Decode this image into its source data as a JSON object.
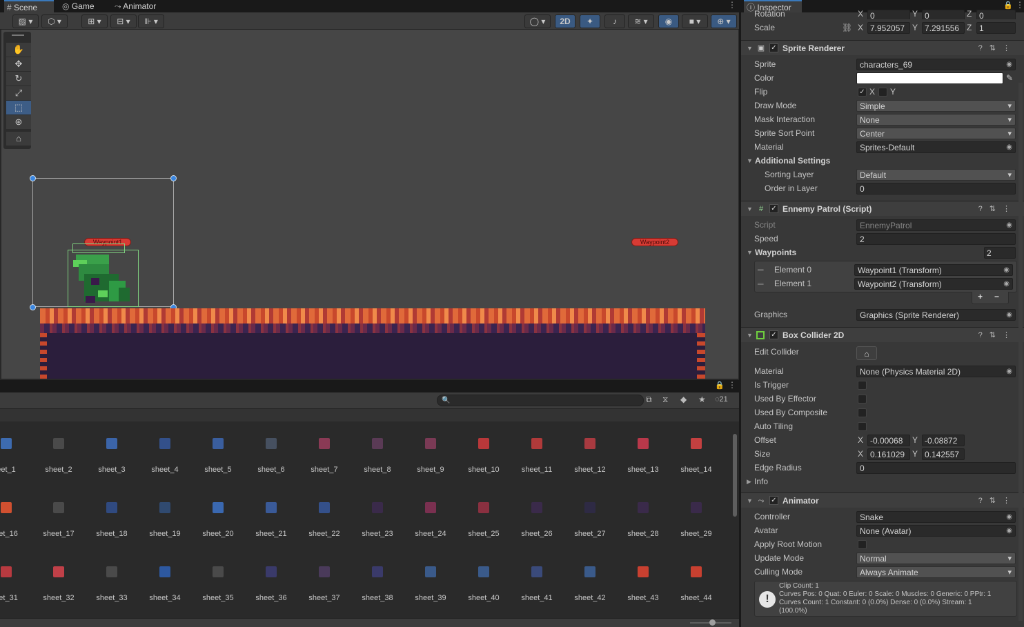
{
  "tabs": {
    "scene": "Scene",
    "game": "Game",
    "animator": "Animator"
  },
  "scene_toolbar": {
    "mode_2d": "2D",
    "badge_count": "21"
  },
  "waypoints_labels": {
    "w1": "Waypoint1",
    "w2": "Waypoint2"
  },
  "inspector": {
    "title": "Inspector",
    "transform": {
      "rotation_label": "Rotation",
      "rot_x": "0",
      "rot_y": "0",
      "rot_z": "0",
      "scale_label": "Scale",
      "scale_x": "7.952057",
      "scale_y": "7.291556",
      "scale_z": "1"
    },
    "sprite_renderer": {
      "title": "Sprite Renderer",
      "sprite_label": "Sprite",
      "sprite_value": "characters_69",
      "color_label": "Color",
      "flip_label": "Flip",
      "flip_x": "X",
      "flip_y": "Y",
      "draw_mode_label": "Draw Mode",
      "draw_mode_value": "Simple",
      "mask_label": "Mask Interaction",
      "mask_value": "None",
      "sort_point_label": "Sprite Sort Point",
      "sort_point_value": "Center",
      "material_label": "Material",
      "material_value": "Sprites-Default",
      "additional_label": "Additional Settings",
      "sorting_layer_label": "Sorting Layer",
      "sorting_layer_value": "Default",
      "order_label": "Order in Layer",
      "order_value": "0"
    },
    "patrol": {
      "title": "Ennemy Patrol (Script)",
      "script_label": "Script",
      "script_value": "EnnemyPatrol",
      "speed_label": "Speed",
      "speed_value": "2",
      "waypoints_label": "Waypoints",
      "waypoints_count": "2",
      "el0_label": "Element 0",
      "el0_value": "Waypoint1 (Transform)",
      "el1_label": "Element 1",
      "el1_value": "Waypoint2 (Transform)",
      "plus": "+",
      "minus": "−",
      "graphics_label": "Graphics",
      "graphics_value": "Graphics (Sprite Renderer)"
    },
    "box_collider": {
      "title": "Box Collider 2D",
      "edit_label": "Edit Collider",
      "material_label": "Material",
      "material_value": "None (Physics Material 2D)",
      "trigger_label": "Is Trigger",
      "effector_label": "Used By Effector",
      "composite_label": "Used By Composite",
      "tiling_label": "Auto Tiling",
      "offset_label": "Offset",
      "offset_x": "-0.00068",
      "offset_y": "-0.08872",
      "size_label": "Size",
      "size_x": "0.161029",
      "size_y": "0.142557",
      "edge_label": "Edge Radius",
      "edge_value": "0",
      "info_label": "Info"
    },
    "animator": {
      "title": "Animator",
      "controller_label": "Controller",
      "controller_value": "Snake",
      "avatar_label": "Avatar",
      "avatar_value": "None (Avatar)",
      "root_label": "Apply Root Motion",
      "update_label": "Update Mode",
      "update_value": "Normal",
      "culling_label": "Culling Mode",
      "culling_value": "Always Animate",
      "info_lines": [
        "Clip Count: 1",
        "Curves Pos: 0 Quat: 0 Euler: 0 Scale: 0 Muscles: 0 Generic: 0 PPtr: 1",
        "Curves Count: 1 Constant: 0 (0.0%) Dense: 0 (0.0%) Stream: 1",
        "(100.0%)"
      ]
    }
  },
  "project": {
    "rows": [
      [
        "eet_1",
        "sheet_2",
        "sheet_3",
        "sheet_4",
        "sheet_5",
        "sheet_6",
        "sheet_7",
        "sheet_8",
        "sheet_9",
        "sheet_10",
        "sheet_11",
        "sheet_12",
        "sheet_13",
        "sheet_14"
      ],
      [
        "eet_16",
        "sheet_17",
        "sheet_18",
        "sheet_19",
        "sheet_20",
        "sheet_21",
        "sheet_22",
        "sheet_23",
        "sheet_24",
        "sheet_25",
        "sheet_26",
        "sheet_27",
        "sheet_28",
        "sheet_29"
      ],
      [
        "eet_31",
        "sheet_32",
        "sheet_33",
        "sheet_34",
        "sheet_35",
        "sheet_36",
        "sheet_37",
        "sheet_38",
        "sheet_39",
        "sheet_40",
        "sheet_41",
        "sheet_42",
        "sheet_43",
        "sheet_44"
      ]
    ],
    "thumb_colors": [
      [
        "#3d6bb0",
        "#4a4a4a",
        "#3b64a8",
        "#33508a",
        "#3a5e9e",
        "#465060",
        "#8a3a55",
        "#5a3a55",
        "#7a3a55",
        "#b8383a",
        "#b03a3a",
        "#a83a40",
        "#b8384a",
        "#c44040"
      ],
      [
        "#d05030",
        "#4a4a4a",
        "#304a80",
        "#304a70",
        "#3a68b0",
        "#3a5a98",
        "#34508a",
        "#3a2a4a",
        "#7a3050",
        "#8a3040",
        "#3a2a4a",
        "#2e2a44",
        "#3a2a4a",
        "#3a2a4a"
      ],
      [
        "#b83a40",
        "#c04048",
        "#4a4a4a",
        "#2d58a0",
        "#4a4a4a",
        "#3a3a6a",
        "#4a3a5a",
        "#3a3a6a",
        "#3a5a8a",
        "#3a5a8a",
        "#3a4a7a",
        "#3a5a8a",
        "#c84030",
        "#c84030"
      ]
    ]
  },
  "colors": {
    "accent": "#3a79bb",
    "selected_tool": "#3d5d86",
    "waypoint": "#d73b34"
  }
}
